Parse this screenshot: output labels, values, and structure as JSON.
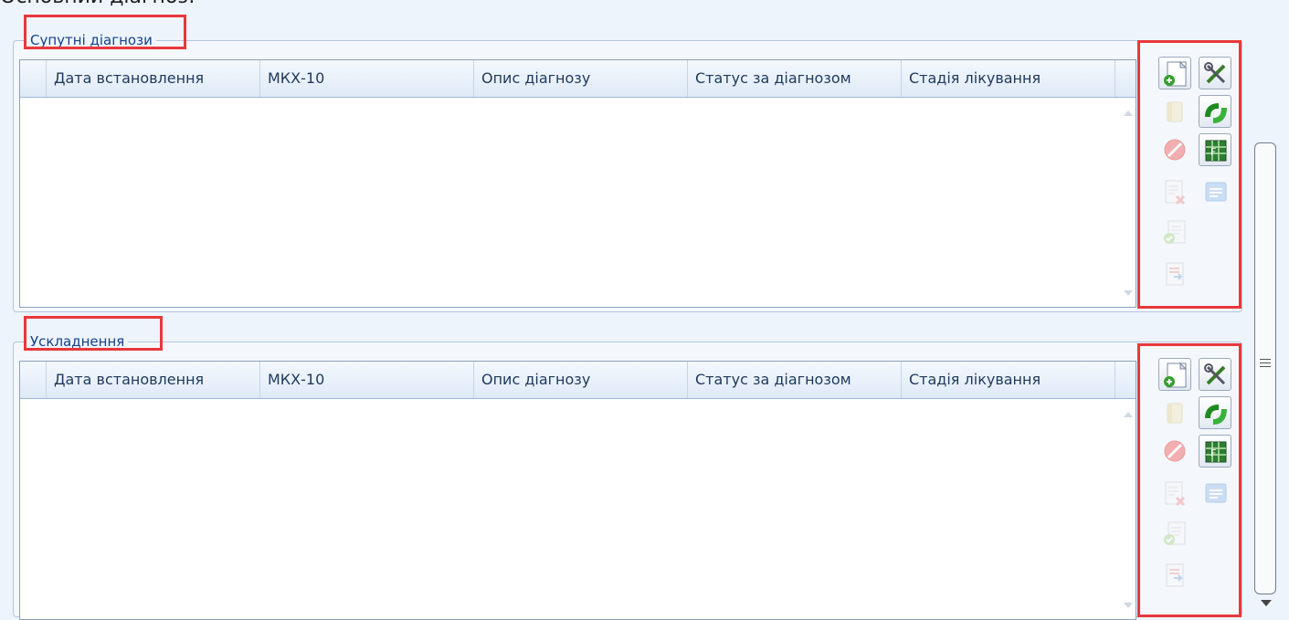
{
  "top_caption": "Основний діагноз:",
  "grid_columns": [
    "Дата встановлення",
    "МКХ-10",
    "Опис діагнозу",
    "Статус за діагнозом",
    "Стадія лікування"
  ],
  "groups": [
    {
      "title": "Супутні діагнози"
    },
    {
      "title": "Ускладнення"
    }
  ],
  "toolbar_icons": [
    {
      "name": "add-document-icon",
      "enabled": true
    },
    {
      "name": "tools-icon",
      "enabled": true
    },
    {
      "name": "book-icon",
      "enabled": false
    },
    {
      "name": "refresh-link-icon",
      "enabled": true
    },
    {
      "name": "forbidden-icon",
      "enabled": false
    },
    {
      "name": "table-grid-icon",
      "enabled": true
    },
    {
      "name": "delete-document-icon",
      "enabled": false
    },
    {
      "name": "list-card-icon",
      "enabled": false
    },
    {
      "name": "approve-document-icon",
      "enabled": false
    },
    {
      "name": "transfer-document-icon",
      "enabled": false
    }
  ],
  "colors": {
    "highlight": "#e8383c",
    "header_text": "#1e395b",
    "group_title": "#15428b"
  }
}
